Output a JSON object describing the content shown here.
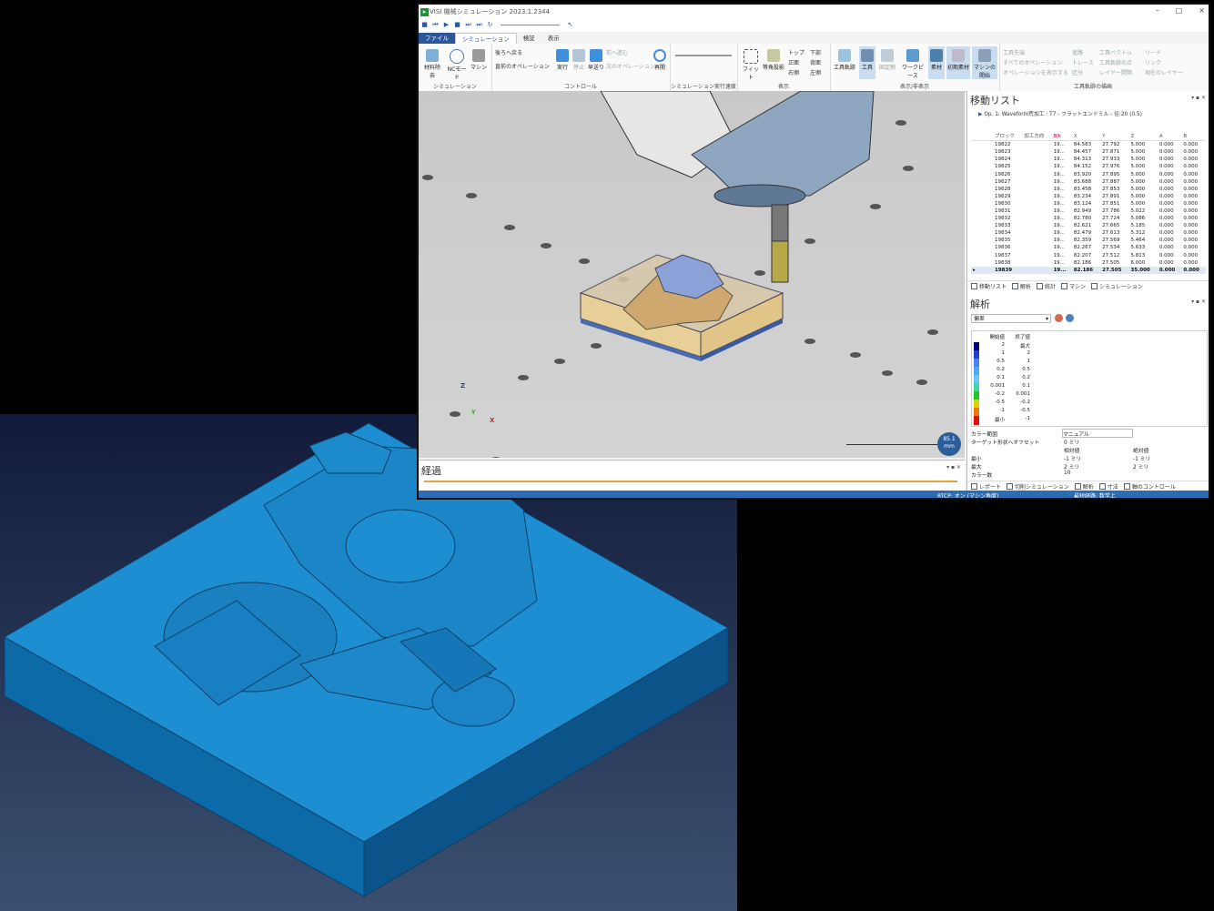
{
  "window": {
    "title": "VISI 機械シミュレーション 2023.1.2344",
    "controls": [
      "–",
      "□",
      "×"
    ]
  },
  "menu_tabs": [
    "ファイル",
    "シミュレーション",
    "検証",
    "表示"
  ],
  "ribbon": {
    "simulation": {
      "buttons": [
        "材料除去",
        "NCモード",
        "マシン"
      ],
      "group_label": "シミュレーション"
    },
    "control": {
      "small": [
        "後ろへ戻る",
        "直前のオペレーション"
      ],
      "buttons": [
        "実行",
        "停止",
        "早送り"
      ],
      "small_right": [
        "前へ進む",
        "次のオペレーション"
      ],
      "restart": "再開",
      "group_label": "コントロール"
    },
    "speed": {
      "group_label": "シミュレーション実行速度"
    },
    "display": {
      "buttons": [
        "フィット",
        "等角投影"
      ],
      "small": [
        "トップ",
        "下部",
        "正面",
        "背面",
        "右側",
        "左側"
      ],
      "group_label": "表示"
    },
    "show_hide": {
      "buttons": [
        "工具軌跡",
        "工具",
        "固定物",
        "ワークピース",
        "素材",
        "初期素材",
        "マシンの開始"
      ],
      "group_label": "表示/非表示"
    },
    "toolpath_display": {
      "small": [
        "工具先端",
        "進路",
        "工具ベクトル",
        "リード",
        "すべてのオペレーション",
        "トレース",
        "工具軌跡の点",
        "リンク",
        "オペレーションを表示する",
        "区分",
        "レイヤー間隔",
        "現在のレイヤー"
      ],
      "group_label": "工具軌跡の描画"
    }
  },
  "viewport": {
    "scale_value": "85.1",
    "scale_unit": "mm",
    "axes": {
      "z": "Z",
      "x": "X",
      "y": "Y"
    }
  },
  "progress_panel": {
    "title": "経過"
  },
  "move_list": {
    "title": "移動リスト",
    "operation": "Op. 1: Waveform荒加工 : T7 - フラットエンドミル - 径:20 (0.5)",
    "columns": [
      "ブロック",
      "加工方向",
      "Blk",
      "X",
      "Y",
      "Z",
      "A",
      "B"
    ],
    "rows": [
      [
        "19822",
        "",
        "19...",
        "84.583",
        "27.792",
        "5.000",
        "0.000",
        "0.000"
      ],
      [
        "19823",
        "",
        "19...",
        "84.457",
        "27.871",
        "5.000",
        "0.000",
        "0.000"
      ],
      [
        "19824",
        "",
        "19...",
        "84.313",
        "27.933",
        "5.000",
        "0.000",
        "0.000"
      ],
      [
        "19825",
        "",
        "19...",
        "84.152",
        "27.976",
        "5.000",
        "0.000",
        "0.000"
      ],
      [
        "19826",
        "",
        "19...",
        "83.920",
        "27.895",
        "5.000",
        "0.000",
        "0.000"
      ],
      [
        "19827",
        "",
        "19...",
        "83.688",
        "27.887",
        "5.000",
        "0.000",
        "0.000"
      ],
      [
        "19828",
        "",
        "19...",
        "83.458",
        "27.853",
        "5.000",
        "0.000",
        "0.000"
      ],
      [
        "19829",
        "",
        "19...",
        "83.234",
        "27.891",
        "5.000",
        "0.000",
        "0.000"
      ],
      [
        "19830",
        "",
        "19...",
        "83.124",
        "27.851",
        "5.000",
        "0.000",
        "0.000"
      ],
      [
        "19831",
        "",
        "19...",
        "82.949",
        "27.786",
        "5.022",
        "0.000",
        "0.000"
      ],
      [
        "19832",
        "",
        "19...",
        "82.780",
        "27.724",
        "5.086",
        "0.000",
        "0.000"
      ],
      [
        "19833",
        "",
        "19...",
        "82.621",
        "27.665",
        "5.185",
        "0.000",
        "0.000"
      ],
      [
        "19834",
        "",
        "19...",
        "82.479",
        "27.613",
        "5.312",
        "0.000",
        "0.000"
      ],
      [
        "19835",
        "",
        "19...",
        "82.359",
        "27.569",
        "5.464",
        "0.000",
        "0.000"
      ],
      [
        "19836",
        "",
        "19...",
        "82.267",
        "27.534",
        "5.633",
        "0.000",
        "0.000"
      ],
      [
        "19837",
        "",
        "19...",
        "82.207",
        "27.512",
        "5.813",
        "0.000",
        "0.000"
      ],
      [
        "19838",
        "",
        "19...",
        "82.186",
        "27.505",
        "6.000",
        "0.000",
        "0.000"
      ],
      [
        "19839",
        "",
        "19...",
        "82.186",
        "27.505",
        "35.000",
        "0.000",
        "0.000"
      ]
    ],
    "tabs": [
      "移動リスト",
      "解析",
      "統計",
      "マシン",
      "シミュレーション"
    ]
  },
  "analysis": {
    "title": "解析",
    "mode": "偏差",
    "legend_headers": [
      "開始値",
      "終了値"
    ],
    "legend_rows": [
      {
        "color": "#00007a",
        "start": "2",
        "end": "最大"
      },
      {
        "color": "#1f3fd6",
        "start": "1",
        "end": "2"
      },
      {
        "color": "#4a7ff0",
        "start": "0.5",
        "end": "1"
      },
      {
        "color": "#4fa8f5",
        "start": "0.2",
        "end": "0.5"
      },
      {
        "color": "#66c6f4",
        "start": "0.1",
        "end": "0.2"
      },
      {
        "color": "#3fd6a6",
        "start": "0.001",
        "end": "0.1"
      },
      {
        "color": "#29c429",
        "start": "-0.2",
        "end": "0.001"
      },
      {
        "color": "#d6d600",
        "start": "-0.5",
        "end": "-0.2"
      },
      {
        "color": "#f07a10",
        "start": "-1",
        "end": "-0.5"
      },
      {
        "color": "#e01010",
        "start": "最小",
        "end": "-1"
      }
    ],
    "props": {
      "color_range_label": "カラー範囲",
      "color_range_value": "マニュアル",
      "offset_label": "ターゲット形状へオフセット",
      "offset_value": "0 ミリ",
      "rel_header": "相対値",
      "abs_header": "絶対値",
      "min_label": "最小",
      "min_rel": "-1 ミリ",
      "min_abs": "-1 ミリ",
      "max_label": "最大",
      "max_rel": "2 ミリ",
      "max_abs": "2 ミリ",
      "count_label": "カラー数",
      "count_value": "10"
    },
    "tabs": [
      "レポート",
      "切削シミュレーション",
      "解析",
      "寸法",
      "軸のコントロール"
    ]
  },
  "status": {
    "rtcp": "RTCP: オン (マシン角度)",
    "shortest": "最短経路: 数学上"
  },
  "colors": {
    "accent": "#2b579a",
    "statusbar": "#2b6cb3",
    "part": "#1a8fd0",
    "stock": "#e8c98a"
  }
}
